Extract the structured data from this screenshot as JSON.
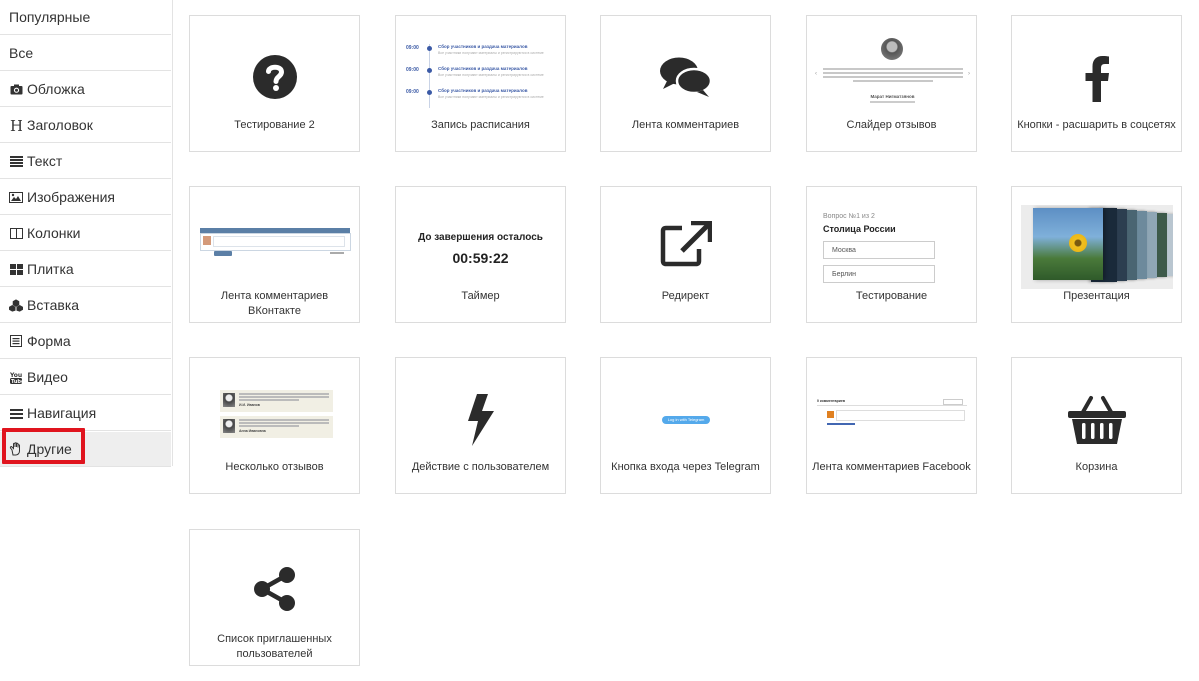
{
  "sidebar": {
    "items": [
      {
        "label": "Популярные",
        "icon": ""
      },
      {
        "label": "Все",
        "icon": ""
      },
      {
        "label": "Обложка",
        "icon": "camera-icon"
      },
      {
        "label": "Заголовок",
        "icon": "heading-icon"
      },
      {
        "label": "Текст",
        "icon": "text-lines-icon"
      },
      {
        "label": "Изображения",
        "icon": "image-icon"
      },
      {
        "label": "Колонки",
        "icon": "columns-icon"
      },
      {
        "label": "Плитка",
        "icon": "tiles-icon"
      },
      {
        "label": "Вставка",
        "icon": "cubes-icon"
      },
      {
        "label": "Форма",
        "icon": "form-icon"
      },
      {
        "label": "Видео",
        "icon": "youtube-icon"
      },
      {
        "label": "Навигация",
        "icon": "menu-icon"
      },
      {
        "label": "Другие",
        "icon": "hand-icon"
      }
    ],
    "active_index": 12,
    "highlight_color": "#e0141e"
  },
  "cards": [
    {
      "label": "Тестирование 2",
      "preview": "question-circle-icon"
    },
    {
      "label": "Запись расписания",
      "preview": "schedule-preview"
    },
    {
      "label": "Лента комментариев",
      "preview": "comments-icon"
    },
    {
      "label": "Слайдер отзывов",
      "preview": "review-slider-preview"
    },
    {
      "label": "Кнопки - расшарить в соцсетях",
      "preview": "facebook-icon"
    },
    {
      "label": "Лента комментариев ВКонтакте",
      "preview": "vk-comments-preview"
    },
    {
      "label": "Таймер",
      "preview": "timer-preview"
    },
    {
      "label": "Редирект",
      "preview": "external-link-icon"
    },
    {
      "label": "Тестирование",
      "preview": "quiz-preview"
    },
    {
      "label": "Презентация",
      "preview": "presentation-preview"
    },
    {
      "label": "Несколько отзывов",
      "preview": "reviews-preview"
    },
    {
      "label": "Действие с пользователем",
      "preview": "bolt-icon"
    },
    {
      "label": "Кнопка входа через Telegram",
      "preview": "telegram-login-preview"
    },
    {
      "label": "Лента комментариев Facebook",
      "preview": "fb-comments-preview"
    },
    {
      "label": "Корзина",
      "preview": "basket-icon"
    },
    {
      "label": "Список приглашенных пользователей",
      "preview": "share-icon"
    }
  ],
  "previews": {
    "schedule": {
      "rows": [
        {
          "time": "09:00",
          "title": "Сбор участников и раздача материалов",
          "desc": "Все участники получают материалы и регистрируются в системе"
        },
        {
          "time": "09:00",
          "title": "Сбор участников и раздача материалов",
          "desc": "Все участники получают материалы и регистрируются в системе"
        },
        {
          "time": "09:00",
          "title": "Сбор участников и раздача материалов",
          "desc": "Все участники получают материалы и регистрируются в системе"
        }
      ]
    },
    "timer": {
      "title": "До завершения осталось",
      "value": "00:59:22"
    },
    "quiz": {
      "step": "Вопрос №1 из 2",
      "question": "Столица России",
      "options": [
        "Москва",
        "Берлин"
      ]
    },
    "review_slider": {
      "name": "Марат Нигматзянов"
    },
    "reviews": {
      "authors": [
        "И.И. Иванов",
        "Анна Ивановна"
      ]
    },
    "telegram": {
      "button": "Log in with Telegram"
    },
    "fb_comments": {
      "count": "0 комментариев"
    }
  }
}
